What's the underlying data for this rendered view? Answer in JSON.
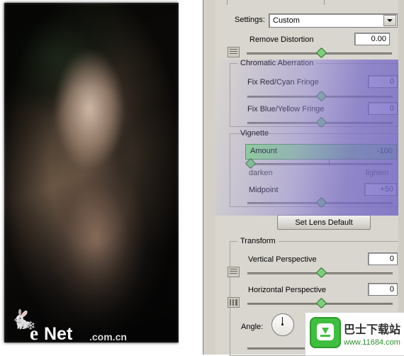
{
  "window": {
    "panel_tab_label": ""
  },
  "settings": {
    "label": "Settings:",
    "value": "Custom",
    "dropdown_icon": "chevron-down-icon",
    "menu_icon": "panel-menu-icon"
  },
  "remove_distortion": {
    "label": "Remove Distortion",
    "value": "0.00",
    "icon": "grid-lines-icon"
  },
  "chromatic": {
    "group_title": "Chromatic Aberration",
    "red_cyan": {
      "label": "Fix Red/Cyan Fringe",
      "value": "0"
    },
    "blue_yellow": {
      "label": "Fix Blue/Yellow Fringe",
      "value": "0"
    }
  },
  "vignette": {
    "group_title": "Vignette",
    "amount": {
      "label": "Amount",
      "value": "-100"
    },
    "scale_left": "darken",
    "scale_right": "lighten",
    "midpoint": {
      "label": "Midpoint",
      "value": "+50"
    }
  },
  "buttons": {
    "set_lens_default": "Set Lens Default"
  },
  "transform": {
    "group_title": "Transform",
    "vertical_perspective": {
      "label": "Vertical Perspective",
      "value": "0",
      "icon": "perspective-vertical-icon"
    },
    "horizontal_perspective": {
      "label": "Horizontal Perspective",
      "value": "0",
      "icon": "perspective-horizontal-icon"
    },
    "angle": {
      "label": "Angle:",
      "dial_icon": "angle-dial-icon"
    }
  },
  "watermark": {
    "brand_e": "e",
    "brand_net": "Net",
    "brand_domain": ".com.cn",
    "butterfly_icon": "butterfly-icon"
  },
  "ad": {
    "title": "巴士下载站",
    "url": "www.11684.com",
    "badge_icon": "download-badge-icon",
    "accent": "#3fbf3f"
  }
}
